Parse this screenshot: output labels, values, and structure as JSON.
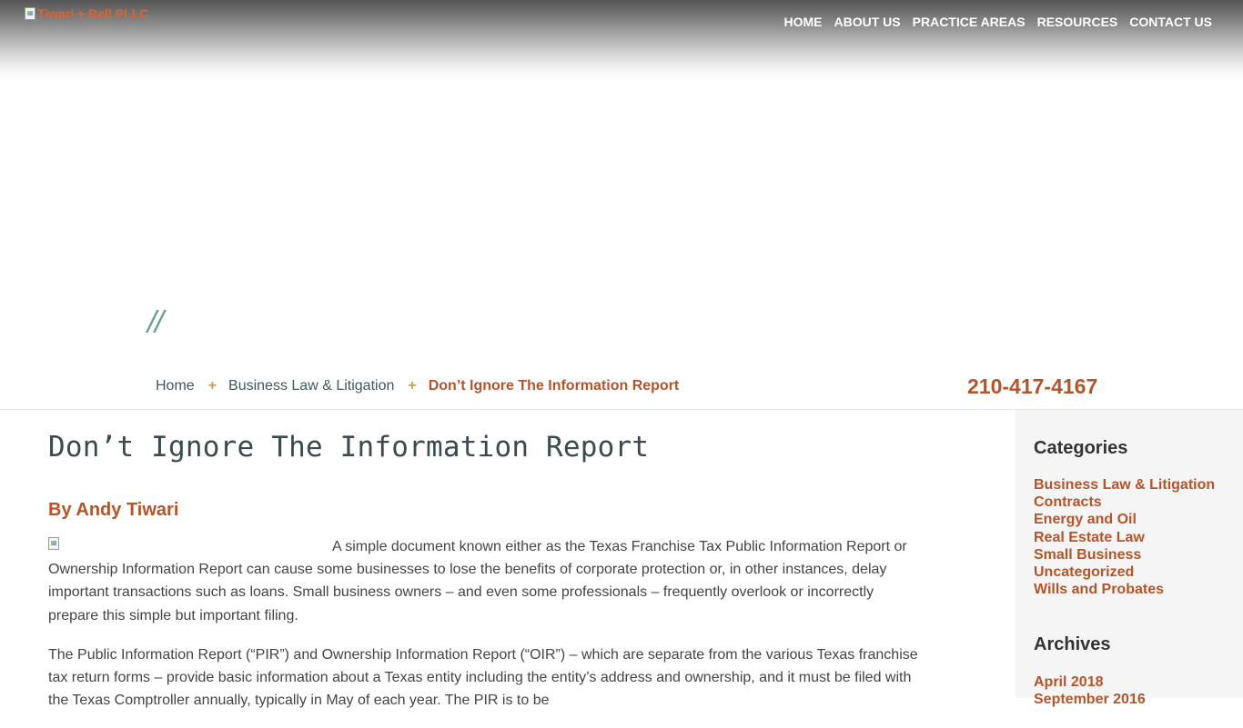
{
  "header": {
    "logo_alt": "Tiwari + Bell PLLC",
    "nav": [
      "HOME",
      "ABOUT US",
      "PRACTICE AREAS",
      "RESOURCES",
      "CONTACT US"
    ]
  },
  "hero": {
    "slashes": "//"
  },
  "breadcrumb": {
    "home": "Home",
    "category": "Business Law & Litigation",
    "current": "Don’t Ignore The Information Report",
    "separator": "+"
  },
  "phone": "210-417-4167",
  "post": {
    "title": "Don’t Ignore The Information Report",
    "byline": "By Andy Tiwari",
    "paragraphs": [
      "A simple document known either as the Texas Franchise Tax Public Information Report or Ownership Information Report can cause some businesses to lose the benefits of corporate protection or, in other instances, delay important transactions such as loans. Small business owners – and even some professionals – frequently overlook or incorrectly prepare this simple but important filing.",
      "The Public Information Report (“PIR”) and Ownership Information Report (“OIR”) – which are separate from the various Texas franchise tax return forms – provide basic information about a Texas entity including the entity’s address and ownership, and it must be filed with the Texas Comptroller annually, typically in May of each year. The PIR is to be"
    ]
  },
  "sidebar": {
    "categories_heading": "Categories",
    "categories": [
      "Business Law & Litigation",
      "Contracts",
      "Energy and Oil",
      "Real Estate Law",
      "Small Business",
      "Uncategorized",
      "Wills and Probates"
    ],
    "archives_heading": "Archives",
    "archives": [
      "April 2018",
      "September 2016"
    ]
  },
  "colors": {
    "accent": "#b4542a",
    "logo_orange": "#e0612b",
    "gold_plus": "#c9a24a",
    "slash_teal": "#6c9c96"
  }
}
